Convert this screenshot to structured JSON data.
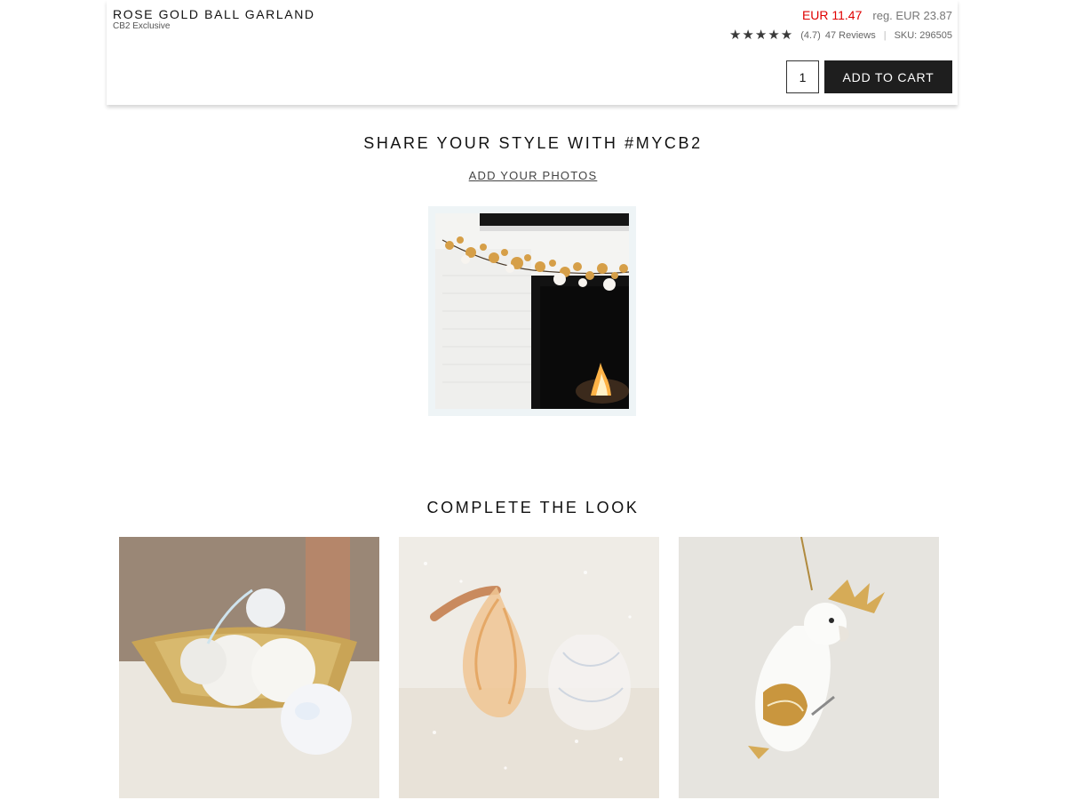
{
  "product": {
    "title": "ROSE GOLD BALL GARLAND",
    "subtitle": "CB2 Exclusive",
    "sale_price": "EUR 11.47",
    "regular_price": "reg. EUR 23.87",
    "rating_value": 4.7,
    "rating_text": "(4.7)",
    "reviews_text": "47 Reviews",
    "sku_text": "SKU: 296505",
    "quantity": "1",
    "add_to_cart_label": "ADD TO CART"
  },
  "share": {
    "heading": "SHARE YOUR STYLE WITH #MYCB2",
    "add_photos_label": "ADD YOUR PHOTOS"
  },
  "complete_look": {
    "heading": "COMPLETE THE LOOK"
  },
  "colors": {
    "sale": "#e00000",
    "button": "#1e1e1e",
    "star": "#3a3a3a"
  }
}
